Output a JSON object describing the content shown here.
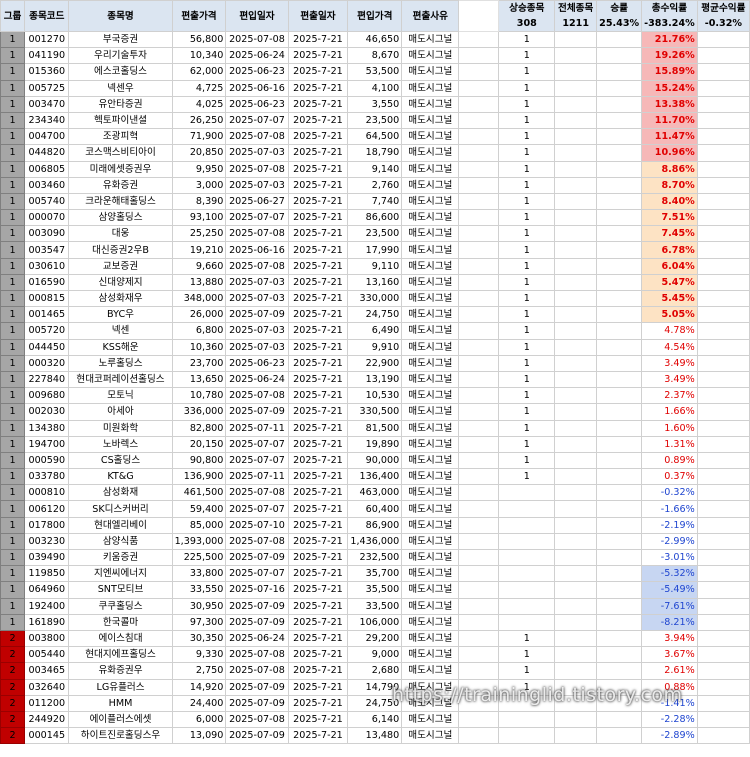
{
  "headers": {
    "group": "그룹",
    "code": "종목코드",
    "name": "종목명",
    "buy_price": "편출가격",
    "in_date": "편입일자",
    "out_date": "편출일자",
    "in_price": "편입가격",
    "reason": "편출사유",
    "rise": "상승종목",
    "total": "전체종목",
    "winrate": "승률",
    "total_return": "총수익률",
    "avg_return": "평균수익률"
  },
  "summary": {
    "rise": "308",
    "total": "1211",
    "winrate": "25.43%",
    "total_return": "-383.24%",
    "avg_return": "-0.32%"
  },
  "rows": [
    {
      "g": "1",
      "code": "001270",
      "name": "부국증권",
      "bp": "56,800",
      "d1": "2025-07-08",
      "d2": "2025-7-21",
      "ip": "46,650",
      "rs": "매도시그널",
      "up": "1",
      "ret": "21.76%",
      "hl": "red"
    },
    {
      "g": "1",
      "code": "041190",
      "name": "우리기술투자",
      "bp": "10,340",
      "d1": "2025-06-24",
      "d2": "2025-7-21",
      "ip": "8,670",
      "rs": "매도시그널",
      "up": "1",
      "ret": "19.26%",
      "hl": "red"
    },
    {
      "g": "1",
      "code": "015360",
      "name": "에스코홀딩스",
      "bp": "62,000",
      "d1": "2025-06-23",
      "d2": "2025-7-21",
      "ip": "53,500",
      "rs": "매도시그널",
      "up": "1",
      "ret": "15.89%",
      "hl": "red"
    },
    {
      "g": "1",
      "code": "005725",
      "name": "넥센우",
      "bp": "4,725",
      "d1": "2025-06-16",
      "d2": "2025-7-21",
      "ip": "4,100",
      "rs": "매도시그널",
      "up": "1",
      "ret": "15.24%",
      "hl": "red"
    },
    {
      "g": "1",
      "code": "003470",
      "name": "유안타증권",
      "bp": "4,025",
      "d1": "2025-06-23",
      "d2": "2025-7-21",
      "ip": "3,550",
      "rs": "매도시그널",
      "up": "1",
      "ret": "13.38%",
      "hl": "red"
    },
    {
      "g": "1",
      "code": "234340",
      "name": "헥토파이낸셜",
      "bp": "26,250",
      "d1": "2025-07-07",
      "d2": "2025-7-21",
      "ip": "23,500",
      "rs": "매도시그널",
      "up": "1",
      "ret": "11.70%",
      "hl": "red"
    },
    {
      "g": "1",
      "code": "004700",
      "name": "조광피혁",
      "bp": "71,900",
      "d1": "2025-07-08",
      "d2": "2025-7-21",
      "ip": "64,500",
      "rs": "매도시그널",
      "up": "1",
      "ret": "11.47%",
      "hl": "red"
    },
    {
      "g": "1",
      "code": "044820",
      "name": "코스맥스비티아이",
      "bp": "20,850",
      "d1": "2025-07-03",
      "d2": "2025-7-21",
      "ip": "18,790",
      "rs": "매도시그널",
      "up": "1",
      "ret": "10.96%",
      "hl": "red"
    },
    {
      "g": "1",
      "code": "006805",
      "name": "미래에셋증권우",
      "bp": "9,950",
      "d1": "2025-07-08",
      "d2": "2025-7-21",
      "ip": "9,140",
      "rs": "매도시그널",
      "up": "1",
      "ret": "8.86%",
      "hl": "org"
    },
    {
      "g": "1",
      "code": "003460",
      "name": "유화증권",
      "bp": "3,000",
      "d1": "2025-07-03",
      "d2": "2025-7-21",
      "ip": "2,760",
      "rs": "매도시그널",
      "up": "1",
      "ret": "8.70%",
      "hl": "org"
    },
    {
      "g": "1",
      "code": "005740",
      "name": "크라운해태홀딩스",
      "bp": "8,390",
      "d1": "2025-06-27",
      "d2": "2025-7-21",
      "ip": "7,740",
      "rs": "매도시그널",
      "up": "1",
      "ret": "8.40%",
      "hl": "org"
    },
    {
      "g": "1",
      "code": "000070",
      "name": "삼양홀딩스",
      "bp": "93,100",
      "d1": "2025-07-07",
      "d2": "2025-7-21",
      "ip": "86,600",
      "rs": "매도시그널",
      "up": "1",
      "ret": "7.51%",
      "hl": "org"
    },
    {
      "g": "1",
      "code": "003090",
      "name": "대웅",
      "bp": "25,250",
      "d1": "2025-07-08",
      "d2": "2025-7-21",
      "ip": "23,500",
      "rs": "매도시그널",
      "up": "1",
      "ret": "7.45%",
      "hl": "org"
    },
    {
      "g": "1",
      "code": "003547",
      "name": "대신증권2우B",
      "bp": "19,210",
      "d1": "2025-06-16",
      "d2": "2025-7-21",
      "ip": "17,990",
      "rs": "매도시그널",
      "up": "1",
      "ret": "6.78%",
      "hl": "org"
    },
    {
      "g": "1",
      "code": "030610",
      "name": "교보증권",
      "bp": "9,660",
      "d1": "2025-07-08",
      "d2": "2025-7-21",
      "ip": "9,110",
      "rs": "매도시그널",
      "up": "1",
      "ret": "6.04%",
      "hl": "org"
    },
    {
      "g": "1",
      "code": "016590",
      "name": "신대양제지",
      "bp": "13,880",
      "d1": "2025-07-03",
      "d2": "2025-7-21",
      "ip": "13,160",
      "rs": "매도시그널",
      "up": "1",
      "ret": "5.47%",
      "hl": "org"
    },
    {
      "g": "1",
      "code": "000815",
      "name": "삼성화재우",
      "bp": "348,000",
      "d1": "2025-07-03",
      "d2": "2025-7-21",
      "ip": "330,000",
      "rs": "매도시그널",
      "up": "1",
      "ret": "5.45%",
      "hl": "org"
    },
    {
      "g": "1",
      "code": "001465",
      "name": "BYC우",
      "bp": "26,000",
      "d1": "2025-07-09",
      "d2": "2025-7-21",
      "ip": "24,750",
      "rs": "매도시그널",
      "up": "1",
      "ret": "5.05%",
      "hl": "org"
    },
    {
      "g": "1",
      "code": "005720",
      "name": "넥센",
      "bp": "6,800",
      "d1": "2025-07-03",
      "d2": "2025-7-21",
      "ip": "6,490",
      "rs": "매도시그널",
      "up": "1",
      "ret": "4.78%",
      "hl": ""
    },
    {
      "g": "1",
      "code": "044450",
      "name": "KSS해운",
      "bp": "10,360",
      "d1": "2025-07-03",
      "d2": "2025-7-21",
      "ip": "9,910",
      "rs": "매도시그널",
      "up": "1",
      "ret": "4.54%",
      "hl": ""
    },
    {
      "g": "1",
      "code": "000320",
      "name": "노루홀딩스",
      "bp": "23,700",
      "d1": "2025-06-23",
      "d2": "2025-7-21",
      "ip": "22,900",
      "rs": "매도시그널",
      "up": "1",
      "ret": "3.49%",
      "hl": ""
    },
    {
      "g": "1",
      "code": "227840",
      "name": "현대코퍼레이션홀딩스",
      "bp": "13,650",
      "d1": "2025-06-24",
      "d2": "2025-7-21",
      "ip": "13,190",
      "rs": "매도시그널",
      "up": "1",
      "ret": "3.49%",
      "hl": ""
    },
    {
      "g": "1",
      "code": "009680",
      "name": "모토닉",
      "bp": "10,780",
      "d1": "2025-07-08",
      "d2": "2025-7-21",
      "ip": "10,530",
      "rs": "매도시그널",
      "up": "1",
      "ret": "2.37%",
      "hl": ""
    },
    {
      "g": "1",
      "code": "002030",
      "name": "아세아",
      "bp": "336,000",
      "d1": "2025-07-09",
      "d2": "2025-7-21",
      "ip": "330,500",
      "rs": "매도시그널",
      "up": "1",
      "ret": "1.66%",
      "hl": ""
    },
    {
      "g": "1",
      "code": "134380",
      "name": "미원화학",
      "bp": "82,800",
      "d1": "2025-07-11",
      "d2": "2025-7-21",
      "ip": "81,500",
      "rs": "매도시그널",
      "up": "1",
      "ret": "1.60%",
      "hl": ""
    },
    {
      "g": "1",
      "code": "194700",
      "name": "노바렉스",
      "bp": "20,150",
      "d1": "2025-07-07",
      "d2": "2025-7-21",
      "ip": "19,890",
      "rs": "매도시그널",
      "up": "1",
      "ret": "1.31%",
      "hl": ""
    },
    {
      "g": "1",
      "code": "000590",
      "name": "CS홀딩스",
      "bp": "90,800",
      "d1": "2025-07-07",
      "d2": "2025-7-21",
      "ip": "90,000",
      "rs": "매도시그널",
      "up": "1",
      "ret": "0.89%",
      "hl": ""
    },
    {
      "g": "1",
      "code": "033780",
      "name": "KT&G",
      "bp": "136,900",
      "d1": "2025-07-11",
      "d2": "2025-7-21",
      "ip": "136,400",
      "rs": "매도시그널",
      "up": "1",
      "ret": "0.37%",
      "hl": ""
    },
    {
      "g": "1",
      "code": "000810",
      "name": "삼성화재",
      "bp": "461,500",
      "d1": "2025-07-08",
      "d2": "2025-7-21",
      "ip": "463,000",
      "rs": "매도시그널",
      "up": "",
      "ret": "-0.32%",
      "hl": ""
    },
    {
      "g": "1",
      "code": "006120",
      "name": "SK디스커버리",
      "bp": "59,400",
      "d1": "2025-07-07",
      "d2": "2025-7-21",
      "ip": "60,400",
      "rs": "매도시그널",
      "up": "",
      "ret": "-1.66%",
      "hl": ""
    },
    {
      "g": "1",
      "code": "017800",
      "name": "현대엘리베이",
      "bp": "85,000",
      "d1": "2025-07-10",
      "d2": "2025-7-21",
      "ip": "86,900",
      "rs": "매도시그널",
      "up": "",
      "ret": "-2.19%",
      "hl": ""
    },
    {
      "g": "1",
      "code": "003230",
      "name": "삼양식품",
      "bp": "1,393,000",
      "d1": "2025-07-08",
      "d2": "2025-7-21",
      "ip": "1,436,000",
      "rs": "매도시그널",
      "up": "",
      "ret": "-2.99%",
      "hl": ""
    },
    {
      "g": "1",
      "code": "039490",
      "name": "키움증권",
      "bp": "225,500",
      "d1": "2025-07-09",
      "d2": "2025-7-21",
      "ip": "232,500",
      "rs": "매도시그널",
      "up": "",
      "ret": "-3.01%",
      "hl": ""
    },
    {
      "g": "1",
      "code": "119850",
      "name": "지엔씨에너지",
      "bp": "33,800",
      "d1": "2025-07-07",
      "d2": "2025-7-21",
      "ip": "35,700",
      "rs": "매도시그널",
      "up": "",
      "ret": "-5.32%",
      "hl": "blu"
    },
    {
      "g": "1",
      "code": "064960",
      "name": "SNT모티브",
      "bp": "33,550",
      "d1": "2025-07-16",
      "d2": "2025-7-21",
      "ip": "35,500",
      "rs": "매도시그널",
      "up": "",
      "ret": "-5.49%",
      "hl": "blu"
    },
    {
      "g": "1",
      "code": "192400",
      "name": "쿠쿠홀딩스",
      "bp": "30,950",
      "d1": "2025-07-09",
      "d2": "2025-7-21",
      "ip": "33,500",
      "rs": "매도시그널",
      "up": "",
      "ret": "-7.61%",
      "hl": "blu"
    },
    {
      "g": "1",
      "code": "161890",
      "name": "한국콜마",
      "bp": "97,300",
      "d1": "2025-07-09",
      "d2": "2025-7-21",
      "ip": "106,000",
      "rs": "매도시그널",
      "up": "",
      "ret": "-8.21%",
      "hl": "blu"
    },
    {
      "g": "2",
      "code": "003800",
      "name": "에이스침대",
      "bp": "30,350",
      "d1": "2025-06-24",
      "d2": "2025-7-21",
      "ip": "29,200",
      "rs": "매도시그널",
      "up": "1",
      "ret": "3.94%",
      "hl": ""
    },
    {
      "g": "2",
      "code": "005440",
      "name": "현대지에프홀딩스",
      "bp": "9,330",
      "d1": "2025-07-08",
      "d2": "2025-7-21",
      "ip": "9,000",
      "rs": "매도시그널",
      "up": "1",
      "ret": "3.67%",
      "hl": ""
    },
    {
      "g": "2",
      "code": "003465",
      "name": "유화증권우",
      "bp": "2,750",
      "d1": "2025-07-08",
      "d2": "2025-7-21",
      "ip": "2,680",
      "rs": "매도시그널",
      "up": "1",
      "ret": "2.61%",
      "hl": ""
    },
    {
      "g": "2",
      "code": "032640",
      "name": "LG유플러스",
      "bp": "14,920",
      "d1": "2025-07-09",
      "d2": "2025-7-21",
      "ip": "14,790",
      "rs": "매도시그널",
      "up": "1",
      "ret": "0.88%",
      "hl": ""
    },
    {
      "g": "2",
      "code": "011200",
      "name": "HMM",
      "bp": "24,400",
      "d1": "2025-07-09",
      "d2": "2025-7-21",
      "ip": "24,750",
      "rs": "매도시그널",
      "up": "",
      "ret": "-1.41%",
      "hl": ""
    },
    {
      "g": "2",
      "code": "244920",
      "name": "에이플러스에셋",
      "bp": "6,000",
      "d1": "2025-07-08",
      "d2": "2025-7-21",
      "ip": "6,140",
      "rs": "매도시그널",
      "up": "",
      "ret": "-2.28%",
      "hl": ""
    },
    {
      "g": "2",
      "code": "000145",
      "name": "하이트진로홀딩스우",
      "bp": "13,090",
      "d1": "2025-07-09",
      "d2": "2025-7-21",
      "ip": "13,480",
      "rs": "매도시그널",
      "up": "",
      "ret": "-2.89%",
      "hl": ""
    }
  ],
  "watermark": "https://traininglid.tistory.com"
}
